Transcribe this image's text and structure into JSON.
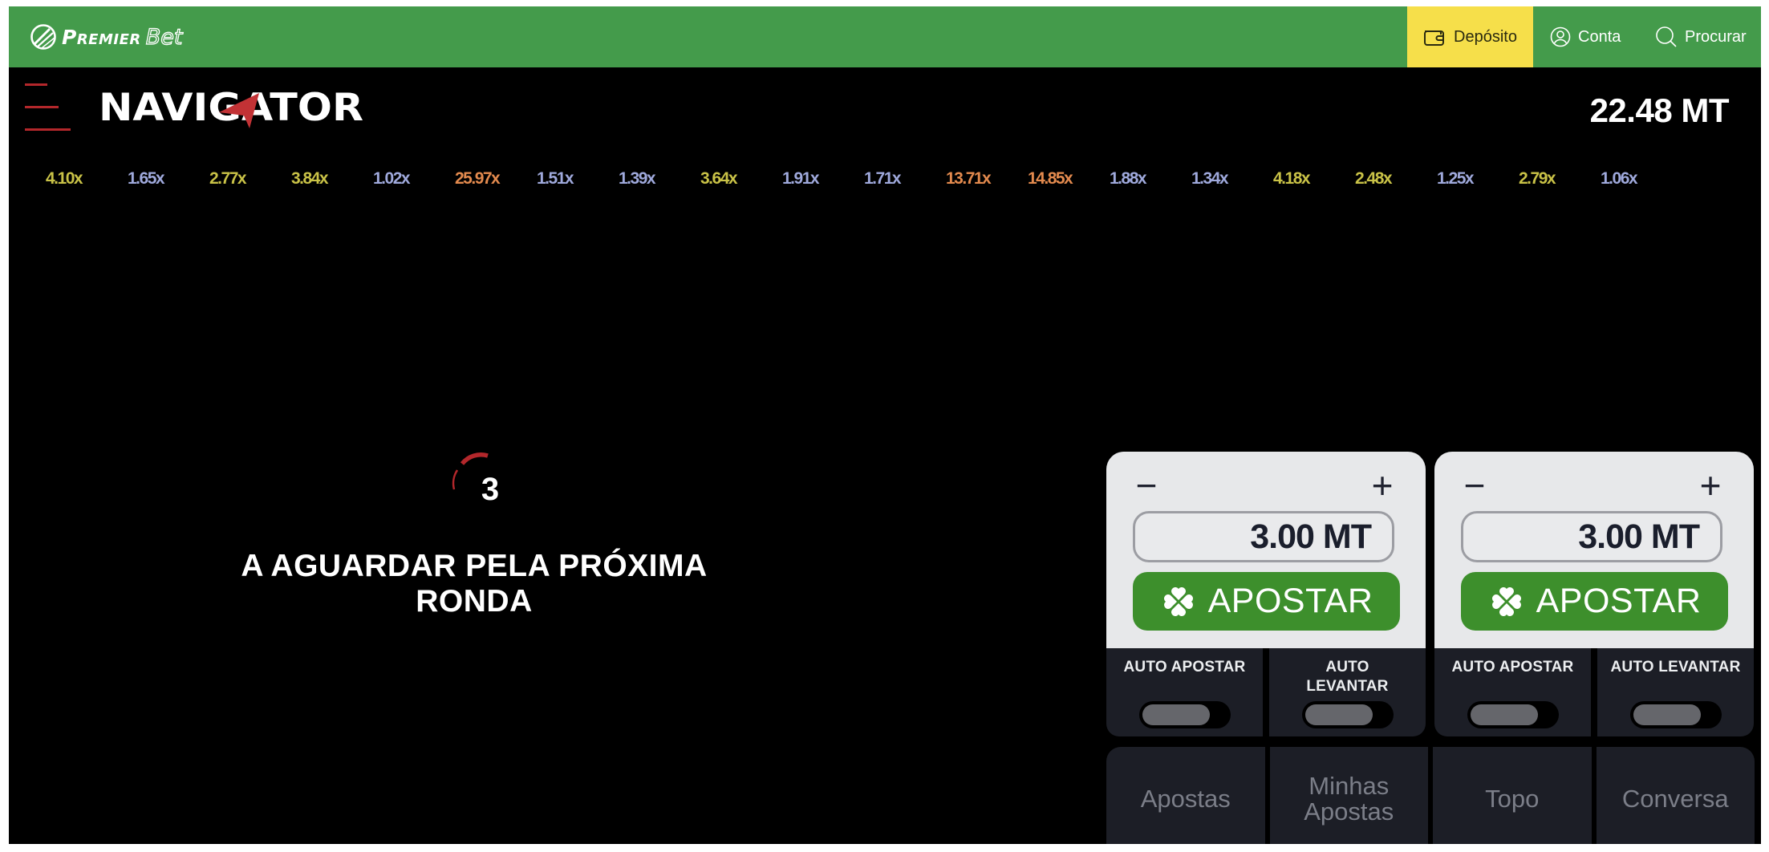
{
  "site_header": {
    "brand_primary": "Premier",
    "brand_secondary": "Bet",
    "deposit_label": "Depósito",
    "account_label": "Conta",
    "search_label": "Procurar",
    "colors": {
      "bar": "#449b4b",
      "deposit": "#f6df4a"
    }
  },
  "game": {
    "title": "NAVIGATOR",
    "balance": "22.48 MT",
    "history": [
      {
        "value": "4.10x",
        "tier": "yellow"
      },
      {
        "value": "1.65x",
        "tier": "blue"
      },
      {
        "value": "2.77x",
        "tier": "yellow"
      },
      {
        "value": "3.84x",
        "tier": "yellow"
      },
      {
        "value": "1.02x",
        "tier": "blue"
      },
      {
        "value": "25.97x",
        "tier": "orange"
      },
      {
        "value": "1.51x",
        "tier": "blue"
      },
      {
        "value": "1.39x",
        "tier": "blue"
      },
      {
        "value": "3.64x",
        "tier": "yellow"
      },
      {
        "value": "1.91x",
        "tier": "blue"
      },
      {
        "value": "1.71x",
        "tier": "blue"
      },
      {
        "value": "13.71x",
        "tier": "orange"
      },
      {
        "value": "14.85x",
        "tier": "orange"
      },
      {
        "value": "1.88x",
        "tier": "blue"
      },
      {
        "value": "1.34x",
        "tier": "blue"
      },
      {
        "value": "4.18x",
        "tier": "yellow"
      },
      {
        "value": "2.48x",
        "tier": "yellow"
      },
      {
        "value": "1.25x",
        "tier": "blue"
      },
      {
        "value": "2.79x",
        "tier": "yellow"
      },
      {
        "value": "1.06x",
        "tier": "blue"
      }
    ],
    "countdown": "3",
    "waiting_message": "A AGUARDAR PELA PRÓXIMA RONDA",
    "accent_color": "#b3272b"
  },
  "bet_panels": [
    {
      "amount": "3.00 MT",
      "minus_label": "−",
      "plus_label": "+",
      "bet_label": "APOSTAR",
      "auto_bet_label": "AUTO APOSTAR",
      "auto_cashout_label": "AUTO LEVANTAR",
      "auto_bet_on": false,
      "auto_cashout_on": false
    },
    {
      "amount": "3.00 MT",
      "minus_label": "−",
      "plus_label": "+",
      "bet_label": "APOSTAR",
      "auto_bet_label": "AUTO APOSTAR",
      "auto_cashout_label": "AUTO LEVANTAR",
      "auto_bet_on": false,
      "auto_cashout_on": false
    }
  ],
  "tabs": [
    {
      "label": "Apostas"
    },
    {
      "label": "Minhas\nApostas"
    },
    {
      "label": "Topo"
    },
    {
      "label": "Conversa"
    }
  ]
}
